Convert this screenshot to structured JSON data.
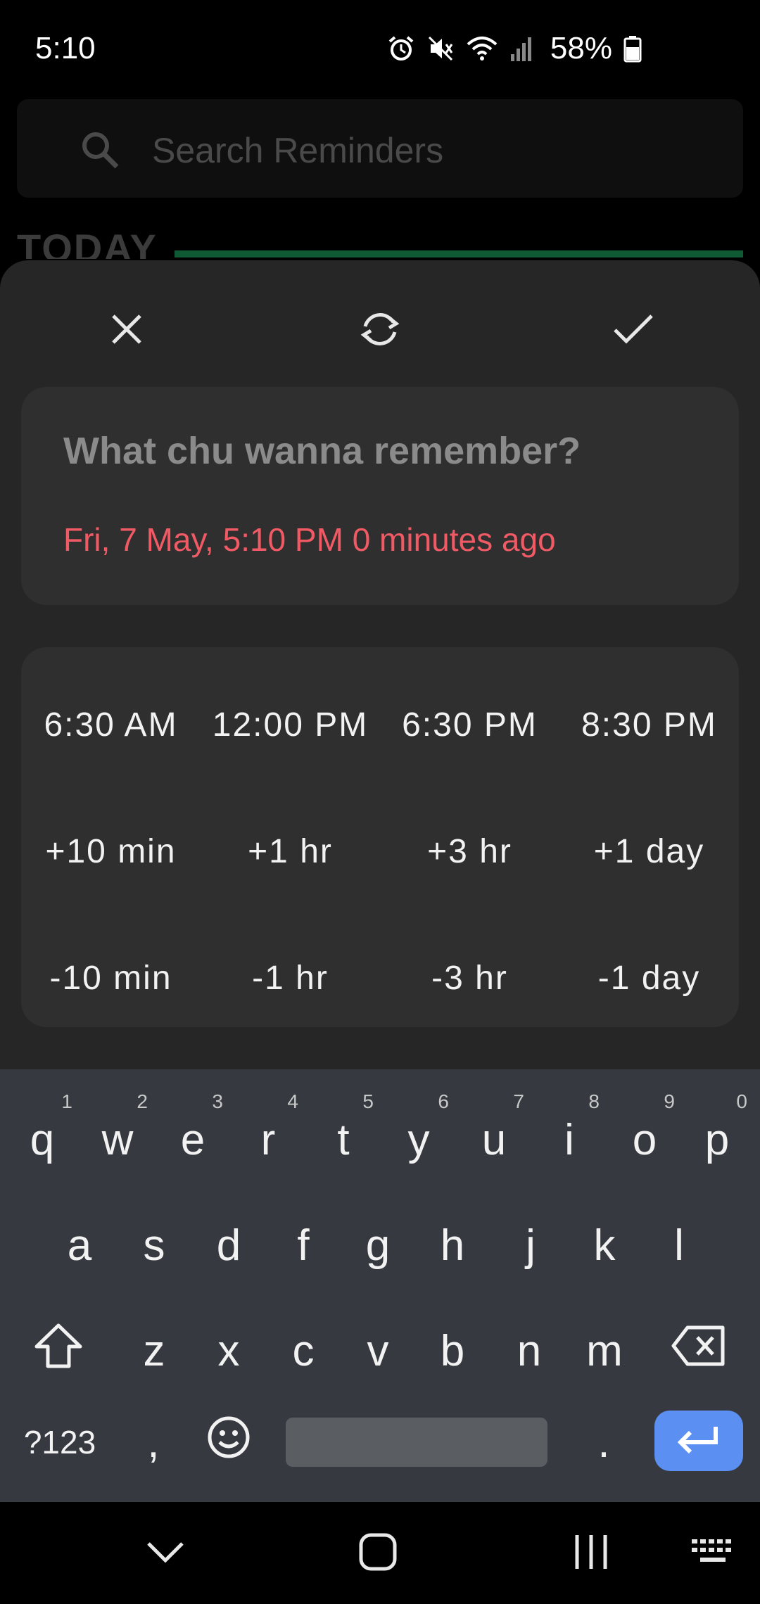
{
  "status": {
    "time": "5:10",
    "battery": "58%"
  },
  "background": {
    "search_placeholder": "Search Reminders",
    "section_label": "TODAY"
  },
  "sheet": {
    "title_placeholder": "What chu wanna remember?",
    "datetime": "Fri, 7 May, 5:10 PM 0 minutes ago",
    "quick_times": {
      "row1": [
        "6:30 AM",
        "12:00 PM",
        "6:30 PM",
        "8:30 PM"
      ],
      "row2": [
        "+10 min",
        "+1 hr",
        "+3 hr",
        "+1 day"
      ],
      "row3": [
        "-10 min",
        "-1 hr",
        "-3 hr",
        "-1 day"
      ]
    }
  },
  "keyboard": {
    "row1": [
      "q",
      "w",
      "e",
      "r",
      "t",
      "y",
      "u",
      "i",
      "o",
      "p"
    ],
    "row1_hints": [
      "1",
      "2",
      "3",
      "4",
      "5",
      "6",
      "7",
      "8",
      "9",
      "0"
    ],
    "row2": [
      "a",
      "s",
      "d",
      "f",
      "g",
      "h",
      "j",
      "k",
      "l"
    ],
    "row3": [
      "z",
      "x",
      "c",
      "v",
      "b",
      "n",
      "m"
    ],
    "symbols_label": "?123",
    "comma": ",",
    "period": "."
  },
  "colors": {
    "accent_red": "#f05a65",
    "accent_green": "#0f5a35",
    "enter_blue": "#5b8ff2",
    "sheet_bg": "#262626",
    "card_bg": "#2f2f2f"
  }
}
